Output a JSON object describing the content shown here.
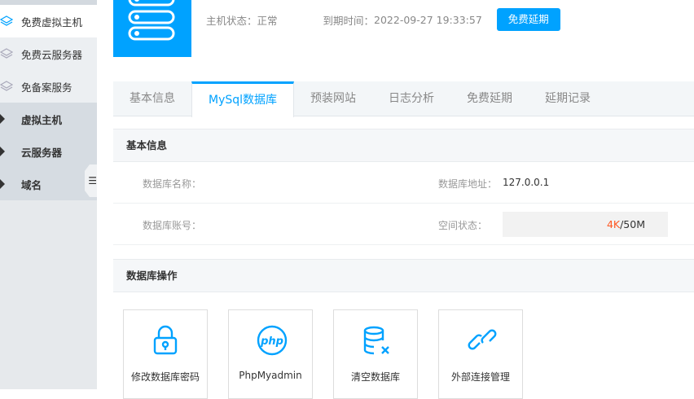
{
  "sidebar": {
    "items": [
      {
        "label": "免费虚拟主机"
      },
      {
        "label": "免费云服务器"
      },
      {
        "label": "免备案服务"
      },
      {
        "label": "虚拟主机"
      },
      {
        "label": "云服务器"
      },
      {
        "label": "域名"
      }
    ]
  },
  "header": {
    "status_label": "主机状态：正常",
    "expire_label": "到期时间：",
    "expire_value": "2022-09-27 19:33:57",
    "renew_button": "免费延期"
  },
  "tabs": [
    {
      "label": "基本信息"
    },
    {
      "label": "MySql数据库"
    },
    {
      "label": "预装网站"
    },
    {
      "label": "日志分析"
    },
    {
      "label": "免费延期"
    },
    {
      "label": "延期记录"
    }
  ],
  "basic": {
    "title": "基本信息",
    "db_name_label": "数据库名称：",
    "db_addr_label": "数据库地址：",
    "db_addr_value": "127.0.0.1",
    "db_account_label": "数据库账号：",
    "space_label": "空间状态：",
    "space_used": "4K",
    "space_total": "/50M"
  },
  "ops": {
    "title": "数据库操作",
    "cards": [
      {
        "label": "修改数据库密码"
      },
      {
        "label": "PhpMyadmin"
      },
      {
        "label": "清空数据库"
      },
      {
        "label": "外部连接管理"
      }
    ]
  },
  "colors": {
    "accent": "#00a2ff",
    "used": "#ff5722"
  }
}
